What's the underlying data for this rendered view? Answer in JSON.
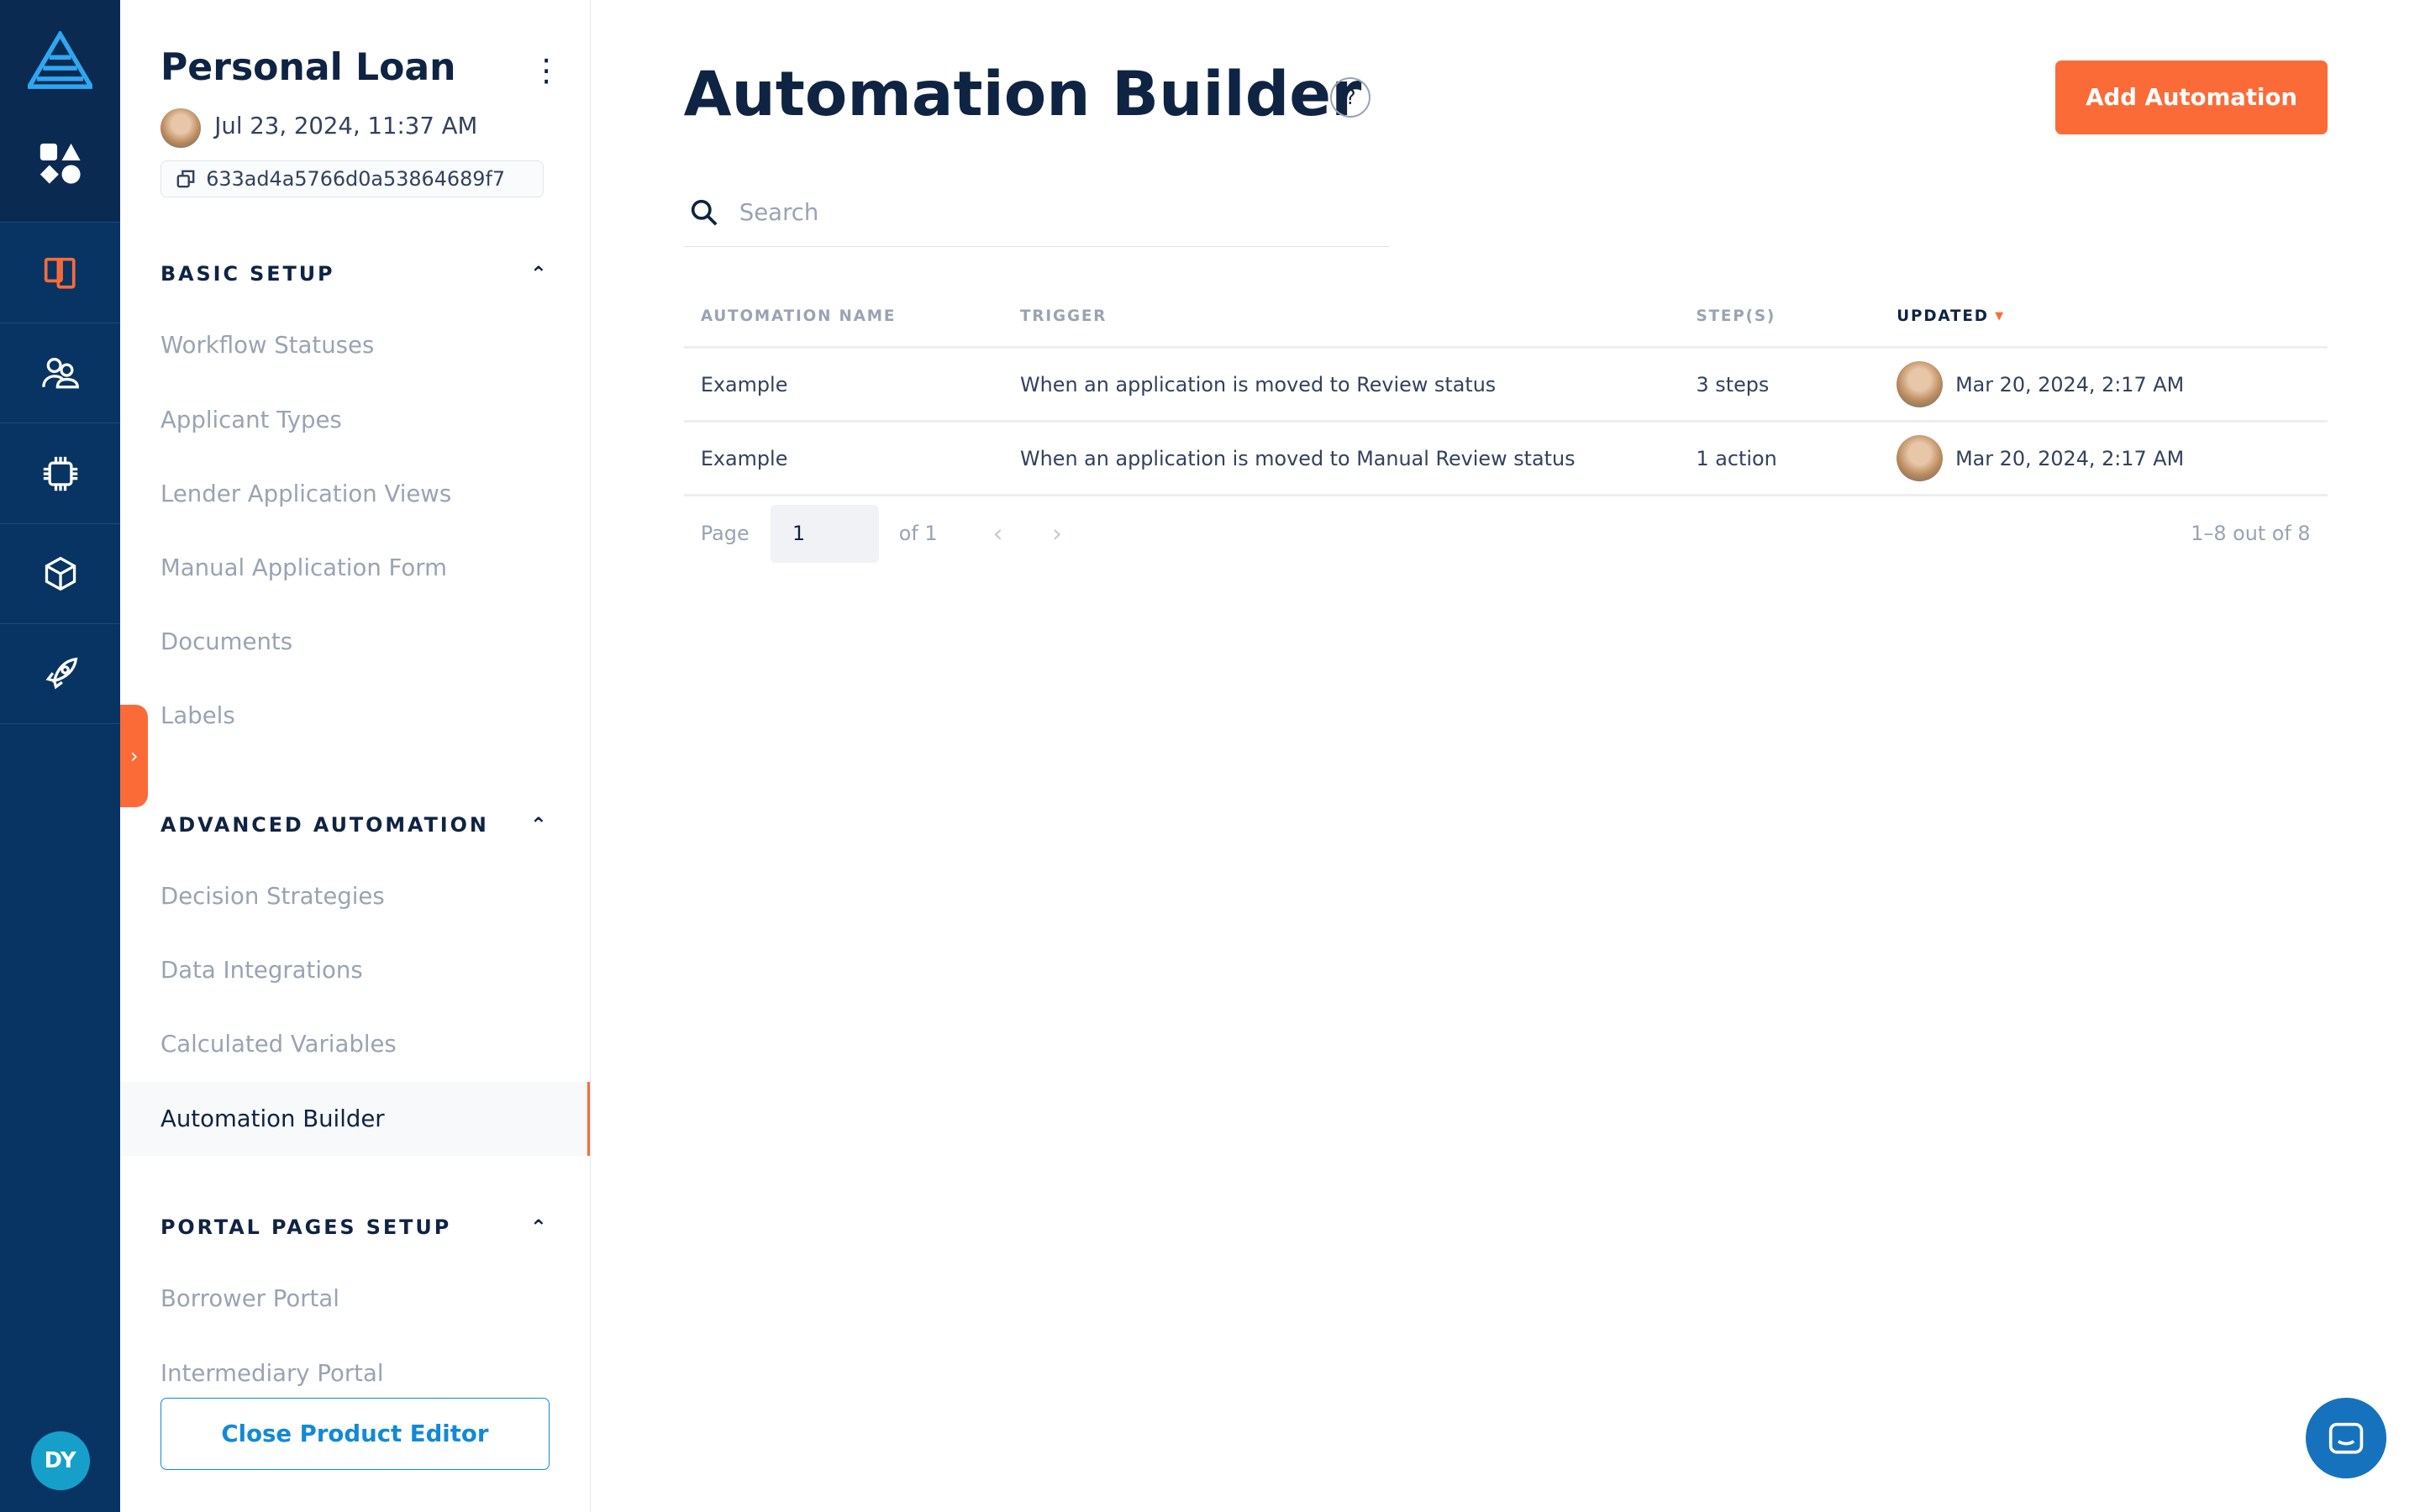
{
  "product": {
    "title": "Personal Loan",
    "date": "Jul 23, 2024, 11:37 AM",
    "id": "633ad4a5766d0a53864689f7"
  },
  "sections": [
    {
      "title": "BASIC SETUP",
      "items": [
        "Workflow Statuses",
        "Applicant Types",
        "Lender Application Views",
        "Manual Application Form",
        "Documents",
        "Labels"
      ]
    },
    {
      "title": "ADVANCED AUTOMATION",
      "items": [
        "Decision Strategies",
        "Data Integrations",
        "Calculated Variables",
        "Automation Builder"
      ]
    },
    {
      "title": "PORTAL PAGES SETUP",
      "items": [
        "Borrower Portal",
        "Intermediary Portal"
      ]
    }
  ],
  "close_label": "Close Product Editor",
  "user_initials": "DY",
  "page": {
    "title": "Automation Builder",
    "help": "?",
    "add_label": "Add Automation",
    "search_placeholder": "Search"
  },
  "table": {
    "headers": [
      "AUTOMATION NAME",
      "TRIGGER",
      "STEP(S)",
      "UPDATED"
    ],
    "rows": [
      [
        "Example",
        "When an application is moved to Review status",
        "3 steps",
        "Mar 20, 2024, 2:17 AM"
      ],
      [
        "Example",
        "When an application is moved to Manual Review status",
        "1 action",
        "Mar 20, 2024, 2:17 AM"
      ]
    ]
  },
  "pager": {
    "label": "Page",
    "value": "1",
    "of": "of 1",
    "range": "1–8 out of 8"
  },
  "colors": {
    "accent": "#fa6b38",
    "rail": "#083463",
    "link": "#1289d8"
  }
}
